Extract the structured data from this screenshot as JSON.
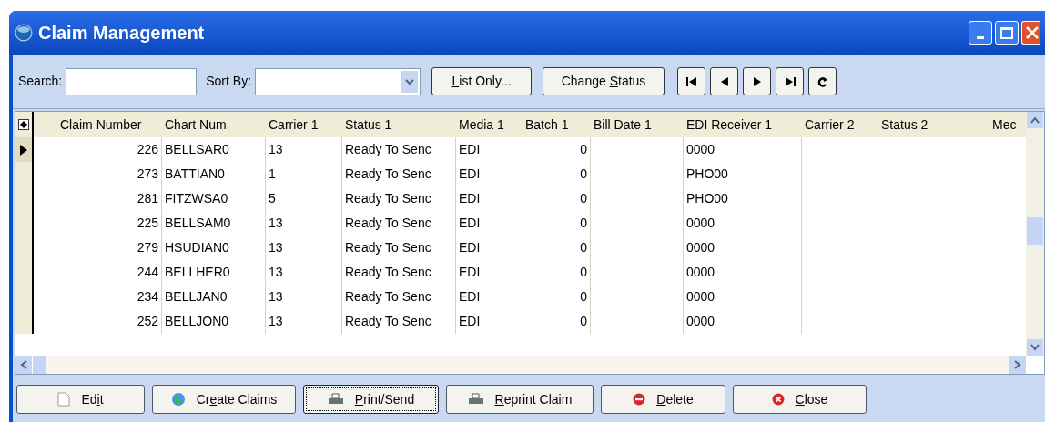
{
  "window": {
    "title": "Claim Management"
  },
  "toolbar": {
    "search_label": "Search:",
    "sort_label": "Sort By:",
    "buttons": [
      {
        "key": "L",
        "after": "ist Only..."
      },
      {
        "before": "Change ",
        "key": "S",
        "after": "tatus"
      }
    ]
  },
  "table": {
    "columns": [
      "Claim Number",
      "Chart Num",
      "Carrier 1",
      "Status 1",
      "Media 1",
      "Batch 1",
      "Bill Date 1",
      "EDI Receiver 1",
      "Carrier 2",
      "Status 2",
      "Mec"
    ],
    "rows": [
      {
        "selected": true,
        "cells": [
          "226",
          "BELLSAR0",
          "13",
          "Ready To Senc",
          "EDI",
          "0",
          "",
          "0000",
          "",
          "",
          ""
        ]
      },
      {
        "selected": false,
        "cells": [
          "273",
          "BATTIAN0",
          "1",
          "Ready To Senc",
          "EDI",
          "0",
          "",
          "PHO00",
          "",
          "",
          ""
        ]
      },
      {
        "selected": false,
        "cells": [
          "281",
          "FITZWSA0",
          "5",
          "Ready To Senc",
          "EDI",
          "0",
          "",
          "PHO00",
          "",
          "",
          ""
        ]
      },
      {
        "selected": false,
        "cells": [
          "225",
          "BELLSAM0",
          "13",
          "Ready To Senc",
          "EDI",
          "0",
          "",
          "0000",
          "",
          "",
          ""
        ]
      },
      {
        "selected": false,
        "cells": [
          "279",
          "HSUDIAN0",
          "13",
          "Ready To Senc",
          "EDI",
          "0",
          "",
          "0000",
          "",
          "",
          ""
        ]
      },
      {
        "selected": false,
        "cells": [
          "244",
          "BELLHER0",
          "13",
          "Ready To Senc",
          "EDI",
          "0",
          "",
          "0000",
          "",
          "",
          ""
        ]
      },
      {
        "selected": false,
        "cells": [
          "234",
          "BELLJAN0",
          "13",
          "Ready To Senc",
          "EDI",
          "0",
          "",
          "0000",
          "",
          "",
          ""
        ]
      },
      {
        "selected": false,
        "cells": [
          "252",
          "BELLJON0",
          "13",
          "Ready To Senc",
          "EDI",
          "0",
          "",
          "0000",
          "",
          "",
          ""
        ]
      }
    ]
  },
  "buttons": [
    {
      "kind": "edit",
      "before": "Ed",
      "key": "i",
      "after": "t",
      "focused": false
    },
    {
      "kind": "create",
      "before": "Cr",
      "key": "e",
      "after": "ate Claims",
      "focused": false
    },
    {
      "kind": "print",
      "key": "P",
      "after": "rint/Send",
      "focused": true
    },
    {
      "kind": "reprint",
      "key": "R",
      "after": "eprint Claim",
      "focused": false
    },
    {
      "kind": "delete",
      "key": "D",
      "after": "elete",
      "focused": false
    },
    {
      "kind": "close",
      "key": "C",
      "after": "lose",
      "focused": false
    }
  ]
}
